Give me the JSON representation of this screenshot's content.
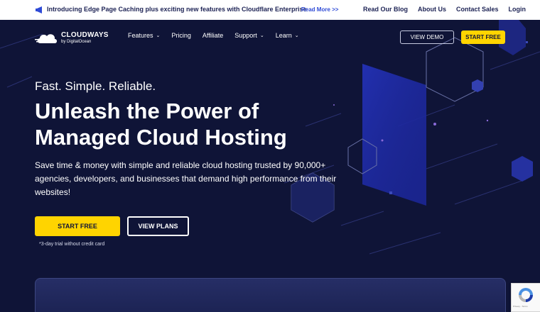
{
  "announcement": {
    "text": "Introducing Edge Page Caching plus exciting new features with Cloudflare Enterprise",
    "link": "Read More >>"
  },
  "top_links": [
    "Read Our Blog",
    "About Us",
    "Contact Sales",
    "Login"
  ],
  "logo": {
    "name": "CLOUDWAYS",
    "sub": "by DigitalOcean"
  },
  "nav": [
    {
      "label": "Features",
      "dropdown": true
    },
    {
      "label": "Pricing",
      "dropdown": false
    },
    {
      "label": "Affiliate",
      "dropdown": false
    },
    {
      "label": "Support",
      "dropdown": true
    },
    {
      "label": "Learn",
      "dropdown": true
    }
  ],
  "header_buttons": {
    "demo": "VIEW DEMO",
    "start": "START FREE"
  },
  "hero": {
    "tagline": "Fast. Simple. Reliable.",
    "headline_line1": "Unleash the Power of",
    "headline_line2": "Managed Cloud Hosting",
    "description": "Save time & money with simple and reliable cloud hosting trusted by 90,000+ agencies, developers, and businesses that demand high performance from their websites!",
    "cta_primary": "START FREE",
    "cta_secondary": "VIEW PLANS",
    "trial_note": "*3-day trial without credit card"
  },
  "recaptcha": {
    "text": "Privacy - Terms"
  },
  "colors": {
    "background": "#0f1437",
    "accent_yellow": "#ffd400",
    "link_blue": "#2f4bd6",
    "text_dark": "#1c2254"
  }
}
